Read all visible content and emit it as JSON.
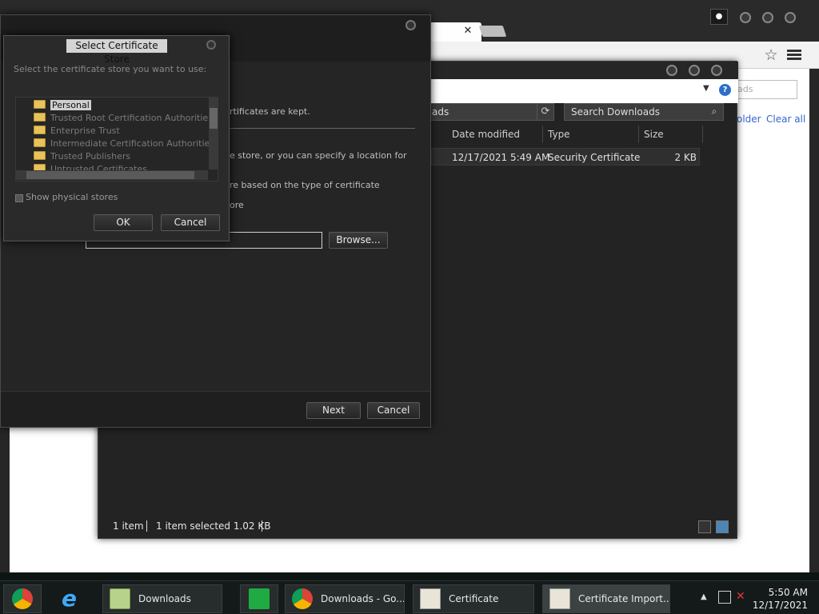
{
  "browser": {
    "colors": {
      "frame": "#262626",
      "link": "#3366cc"
    },
    "page_search_placeholder": "ads",
    "links": {
      "folder": "older",
      "clear_all": "Clear all"
    }
  },
  "explorer": {
    "path_text": "ads",
    "search_placeholder": "Search Downloads",
    "columns": {
      "date": "Date modified",
      "type": "Type",
      "size": "Size"
    },
    "rows": [
      {
        "date": "12/17/2021 5:49 AM",
        "type": "Security Certificate",
        "size": "2 KB"
      }
    ],
    "status": {
      "count": "1 item",
      "selected": "1 item selected  1.02 KB"
    }
  },
  "wizard": {
    "frag_kept": "rtificates are kept.",
    "frag_store": "e store, or you can specify a location for",
    "frag_auto": "re based on the type of certificate",
    "frag_place": "ore",
    "browse_label": "Browse...",
    "next_label": "Next",
    "cancel_label": "Cancel"
  },
  "store_dialog": {
    "title": "Select Certificate Store",
    "instruction": "Select the certificate store you want to use:",
    "stores": [
      "Personal",
      "Trusted Root Certification Authorities",
      "Enterprise Trust",
      "Intermediate Certification Authorities",
      "Trusted Publishers",
      "Untrusted Certificates"
    ],
    "selected_index": 0,
    "show_physical_label": "Show physical stores",
    "show_physical_checked": false,
    "ok_label": "OK",
    "cancel_label": "Cancel"
  },
  "taskbar": {
    "items": [
      {
        "label": "",
        "icon": "chrome-launcher-icon"
      },
      {
        "label": "",
        "icon": "internet-explorer-icon"
      },
      {
        "label": "Downloads",
        "icon": "folder-icon"
      },
      {
        "label": "",
        "icon": "store-icon"
      },
      {
        "label": "Downloads - Go...",
        "icon": "chrome-icon"
      },
      {
        "label": "Certificate",
        "icon": "certificate-icon"
      },
      {
        "label": "Certificate Import...",
        "icon": "certificate-import-icon"
      }
    ],
    "clock": {
      "time": "5:50 AM",
      "date": "12/17/2021"
    }
  }
}
